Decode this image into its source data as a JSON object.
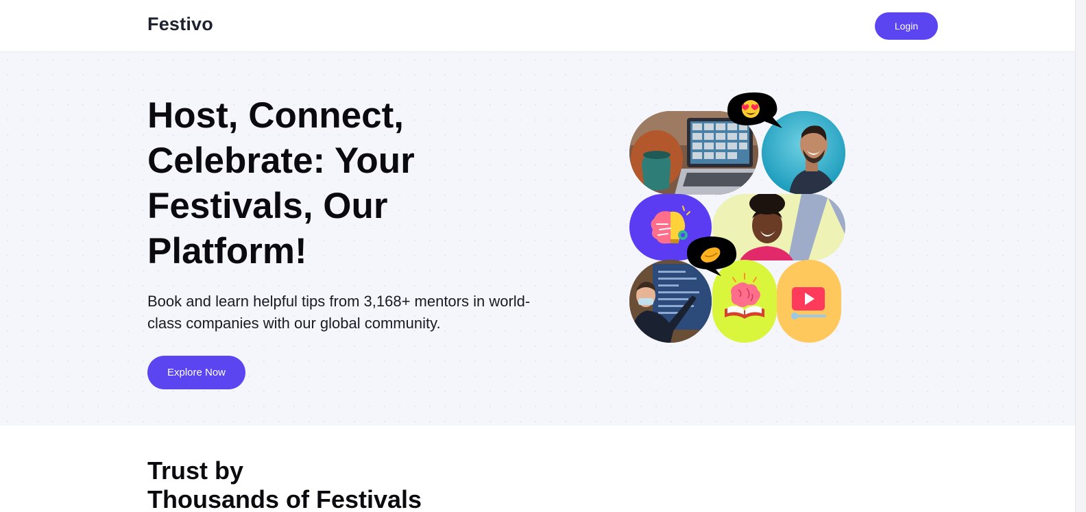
{
  "nav": {
    "brand": "Festivo",
    "login_label": "Login"
  },
  "hero": {
    "title": "Host, Connect, Celebrate: Your Festivals, Our Platform!",
    "subtitle": "Book and learn helpful tips from 3,168+ mentors in world-class companies with our global community.",
    "cta_label": "Explore Now",
    "collage_icons": [
      "heart-eyes-emoji-icon",
      "video-call-photo",
      "laughing-man-photo",
      "brain-lightbulb-icon",
      "smiling-woman-photo",
      "handshake-emoji-icon",
      "teacher-whiteboard-photo",
      "brain-book-icon",
      "video-play-icon"
    ]
  },
  "trust": {
    "title_line1": "Trust by",
    "title_line2": "Thousands of Festivals"
  },
  "colors": {
    "accent": "#5b45f0",
    "hero_bg": "#f4f6fb",
    "lime": "#d9f53c",
    "amber": "#ffc85c"
  }
}
